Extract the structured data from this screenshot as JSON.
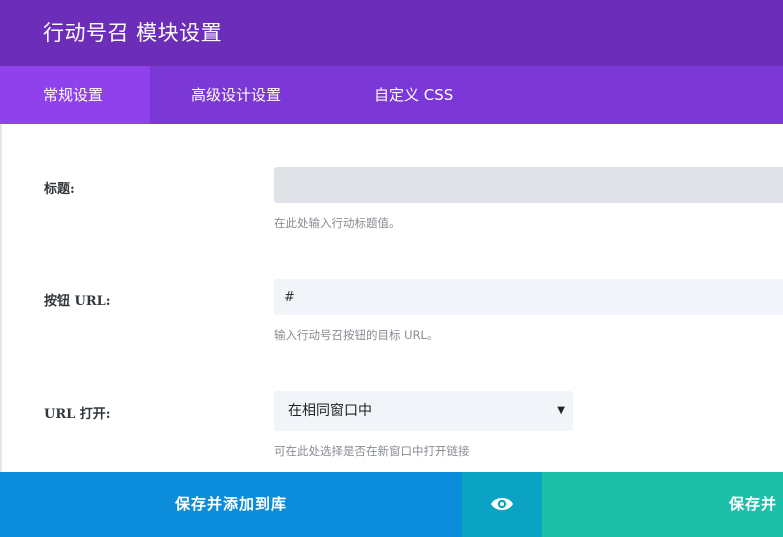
{
  "window": {
    "title": "行动号召 模块设置"
  },
  "tabs": [
    {
      "label": "常规设置",
      "active": true
    },
    {
      "label": "高级设计设置",
      "active": false
    },
    {
      "label": "自定义 CSS",
      "active": false
    }
  ],
  "fields": {
    "title": {
      "label": "标题:",
      "value": "",
      "help": "在此处输入行动标题值。"
    },
    "button_url": {
      "label": "按钮 URL:",
      "value": "#",
      "help": "输入行动号召按钮的目标 URL。"
    },
    "url_open": {
      "label": "URL 打开:",
      "selected": "在相同窗口中",
      "help": "可在此处选择是否在新窗口中打开链接"
    }
  },
  "footer": {
    "save_to_library": "保存并添加到库",
    "preview_icon": "eye-icon",
    "save_exit": "保存并"
  },
  "colors": {
    "title_bar": "#6c2eb9",
    "tab_bar": "#7b38d6",
    "active_tab": "#8f42ec",
    "save_library": "#0b8ddc",
    "preview": "#0aa3c4",
    "save": "#1cc0a8"
  }
}
